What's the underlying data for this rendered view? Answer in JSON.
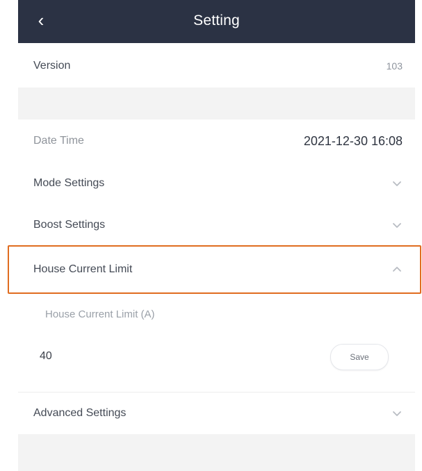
{
  "header": {
    "title": "Setting"
  },
  "version": {
    "label": "Version",
    "value": "103"
  },
  "datetime": {
    "label": "Date Time",
    "value": "2021-12-30 16:08"
  },
  "mode": {
    "label": "Mode Settings"
  },
  "boost": {
    "label": "Boost Settings"
  },
  "house_limit": {
    "label": "House Current Limit",
    "subpanel": {
      "field_label": "House Current Limit (A)",
      "value": "40",
      "save_label": "Save"
    }
  },
  "advanced": {
    "label": "Advanced Settings"
  },
  "colors": {
    "header_bg": "#2b3244",
    "highlight": "#e06c1f",
    "band": "#f3f3f3"
  }
}
